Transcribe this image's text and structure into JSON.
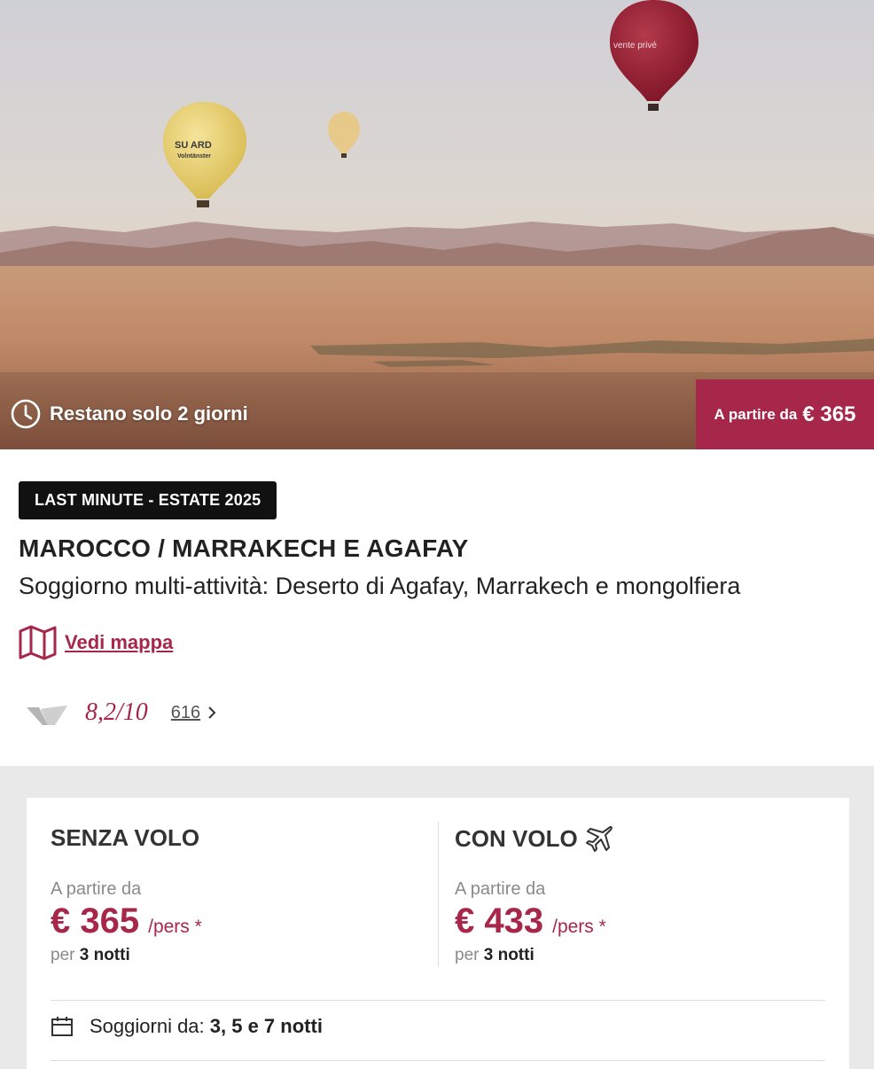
{
  "hero": {
    "countdown_text": "Restano solo 2 giorni",
    "price_label": "A partire da",
    "price_value": "€ 365",
    "balloon_text_1": "SU  ARD",
    "balloon_text_2": "Volntänster",
    "balloon_logo_text": "vente privé"
  },
  "offer": {
    "badge": "LAST MINUTE - ESTATE 2025",
    "destination": "MAROCCO / MARRAKECH E AGAFAY",
    "subtitle": "Soggiorno multi-attività: Deserto di Agafay, Marrakech e mongolfiera",
    "map_link": "Vedi mappa",
    "rating_score": "8,2/10",
    "review_count": "616"
  },
  "pricing": {
    "without_flight": {
      "title": "SENZA VOLO",
      "from_label": "A partire da",
      "price": "€ 365",
      "unit": "/pers *",
      "nights_prefix": "per",
      "nights_value": "3 notti"
    },
    "with_flight": {
      "title": "CON VOLO",
      "from_label": "A partire da",
      "price": "€ 433",
      "unit": "/pers *",
      "nights_prefix": "per",
      "nights_value": "3 notti"
    },
    "stays_label": "Soggiorni da:",
    "stays_value": "3, 5 e 7 notti"
  },
  "colors": {
    "brand": "#a6274a",
    "badge_bg": "#111111",
    "panel_bg": "#e9e9e9"
  },
  "icons": [
    "clock-icon",
    "map-icon",
    "vp-logo-icon",
    "chevron-right-icon",
    "plane-icon",
    "calendar-icon"
  ]
}
